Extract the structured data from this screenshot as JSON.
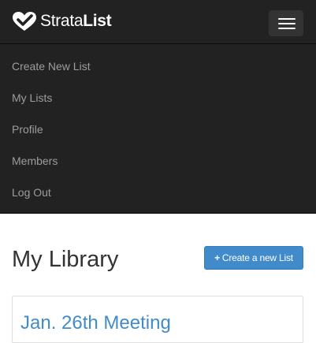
{
  "brand": {
    "name_regular": "Strata",
    "name_bold": "List",
    "logo_icon": "check-heart-logo"
  },
  "navbar": {
    "toggle_icon": "hamburger-menu-icon",
    "menu_items": [
      {
        "label": "Create New List"
      },
      {
        "label": "My Lists"
      },
      {
        "label": "Profile"
      },
      {
        "label": "Members"
      },
      {
        "label": "Log Out"
      }
    ]
  },
  "main": {
    "title": "My Library",
    "create_button": {
      "icon": "plus-icon",
      "icon_glyph": "+",
      "label": "Create a new List"
    },
    "lists": [
      {
        "title": "Jan. 26th Meeting"
      }
    ]
  },
  "colors": {
    "navbar_bg": "#222222",
    "nav_link": "#9d9d9d",
    "primary": "#428bca",
    "title_text": "#333333"
  }
}
